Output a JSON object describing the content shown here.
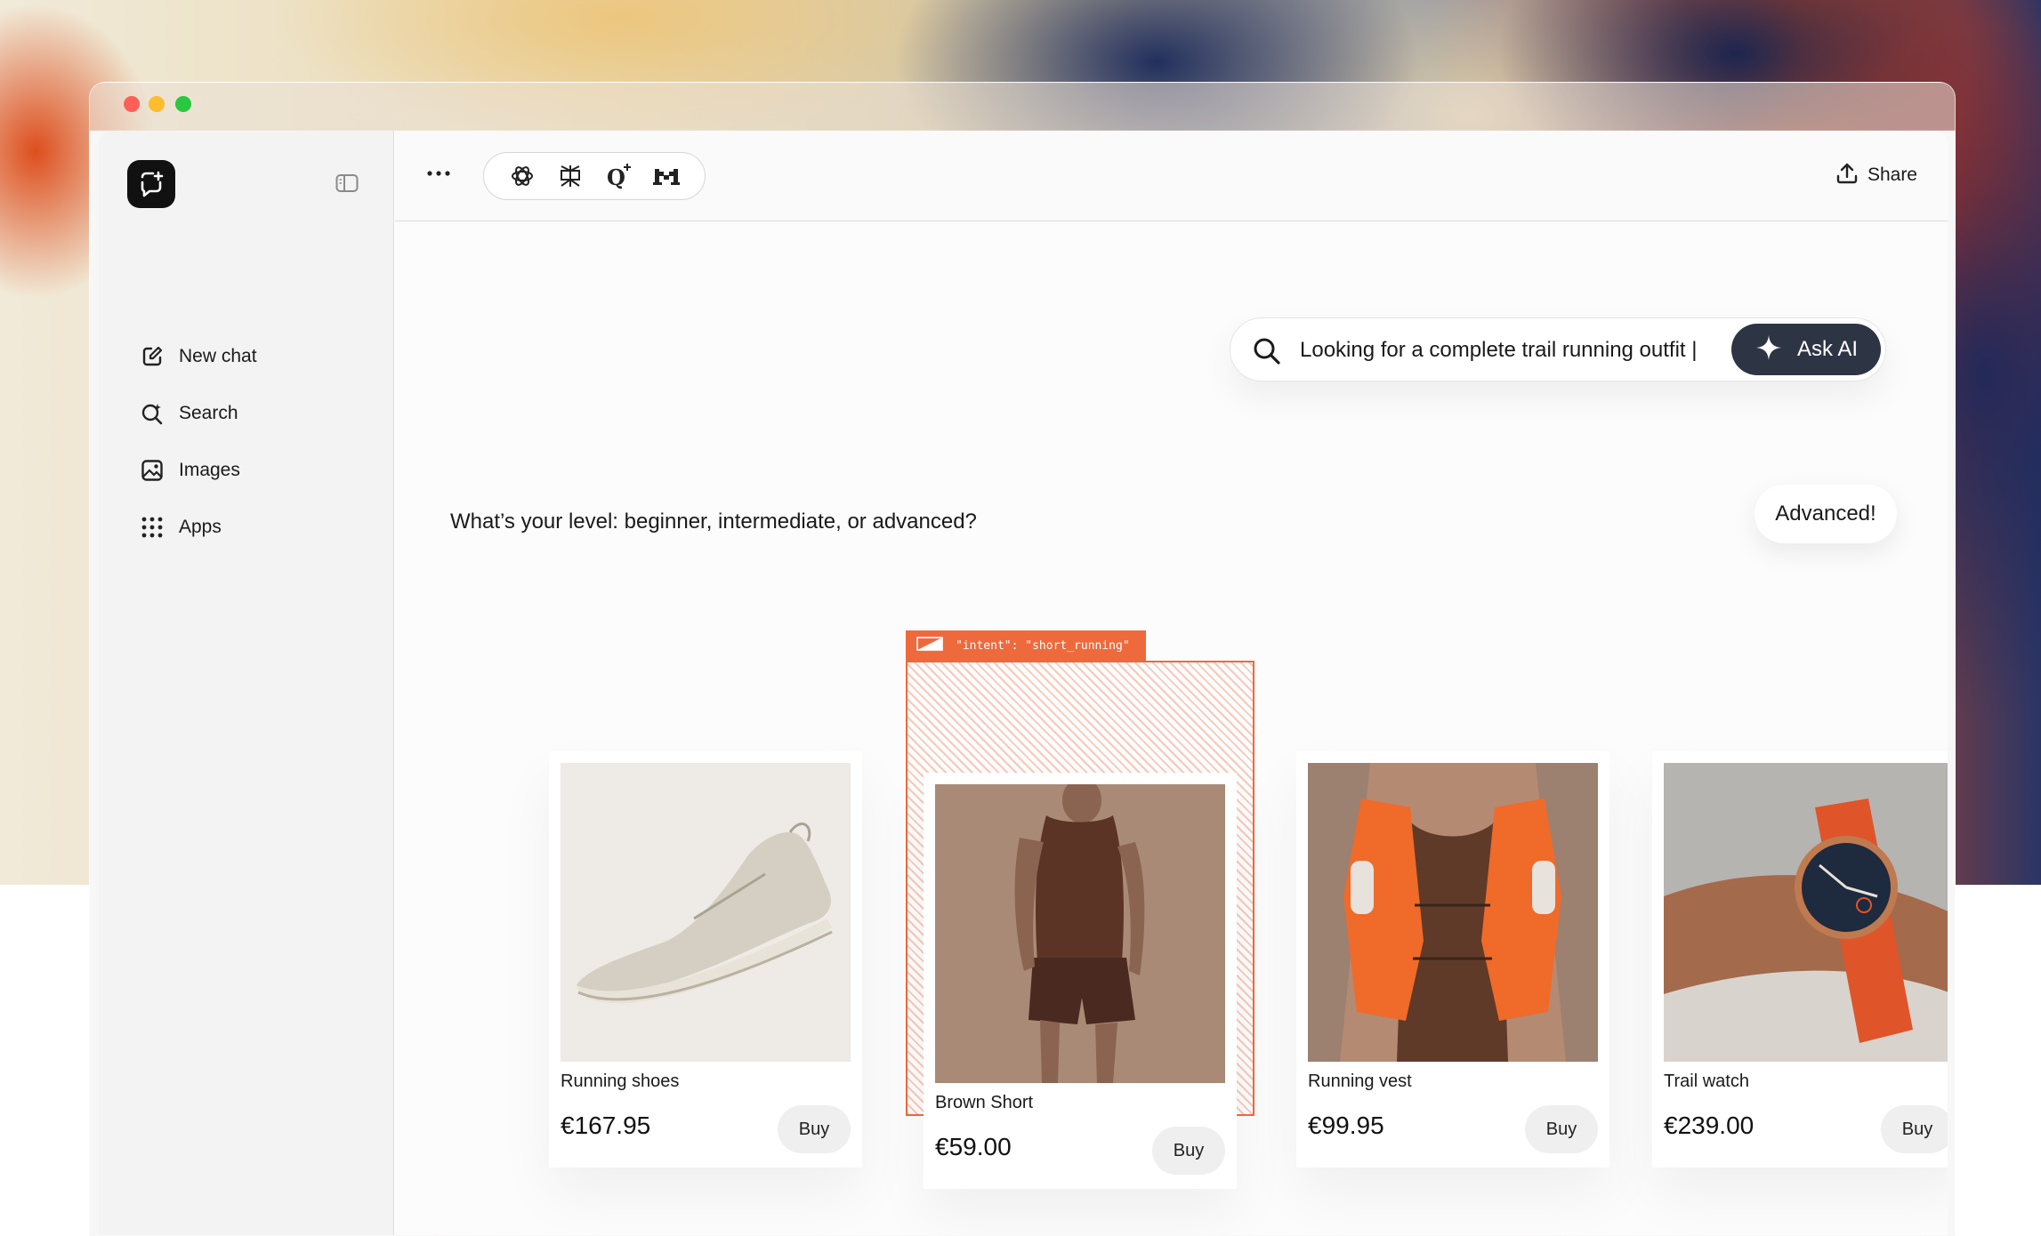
{
  "sidebar": {
    "items": [
      {
        "label": "New chat",
        "icon": "new-chat-icon"
      },
      {
        "label": "Search",
        "icon": "search-sparkle-icon"
      },
      {
        "label": "Images",
        "icon": "images-icon"
      },
      {
        "label": "Apps",
        "icon": "apps-grid-icon"
      }
    ]
  },
  "topbar": {
    "models": [
      "openai-icon",
      "perplexity-icon",
      "qwen-icon",
      "mistral-icon"
    ],
    "share_label": "Share"
  },
  "search": {
    "query": "Looking for a complete trail running outfit |",
    "ask_label": "Ask AI"
  },
  "chat": {
    "question": "What’s your level: beginner, intermediate, or advanced?",
    "reply": "Advanced!"
  },
  "intent_tag": "\"intent\": \"short_running\"",
  "products": [
    {
      "name": "Running shoes",
      "price": "€167.95",
      "buy_label": "Buy"
    },
    {
      "name": "Brown Short",
      "price": "€59.00",
      "buy_label": "Buy"
    },
    {
      "name": "Running vest",
      "price": "€99.95",
      "buy_label": "Buy"
    },
    {
      "name": "Trail watch",
      "price": "€239.00",
      "buy_label": "Buy"
    }
  ],
  "colors": {
    "accent": "#ee6a3c",
    "ask_button": "#2d3444",
    "sidebar_bg": "#f3f3f3"
  }
}
